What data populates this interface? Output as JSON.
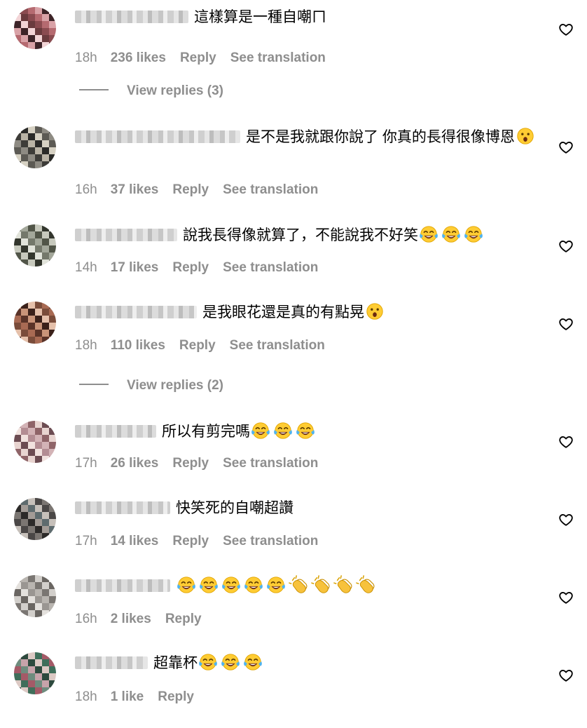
{
  "icons": {
    "like": "heart-outline-icon"
  },
  "comments": [
    {
      "text": "這樣算是一種自嘲ㄇ",
      "emoji": [],
      "time": "18h",
      "likes": "236 likes",
      "reply": "Reply",
      "translate": "See translation"
    },
    {
      "text": "是不是我就跟你說了 你真的長得很像博恩",
      "emoji": [
        "hushed-face"
      ],
      "time": "16h",
      "likes": "37 likes",
      "reply": "Reply",
      "translate": "See translation"
    },
    {
      "text": "說我長得像就算了，不能說我不好笑",
      "emoji": [
        "tears-of-joy",
        "tears-of-joy",
        "tears-of-joy"
      ],
      "time": "14h",
      "likes": "17 likes",
      "reply": "Reply",
      "translate": "See translation"
    },
    {
      "text": "是我眼花還是真的有點晃",
      "emoji": [
        "hushed-face"
      ],
      "time": "18h",
      "likes": "110 likes",
      "reply": "Reply",
      "translate": "See translation"
    },
    {
      "text": "所以有剪完嗎",
      "emoji": [
        "tears-of-joy",
        "tears-of-joy",
        "tears-of-joy"
      ],
      "time": "17h",
      "likes": "26 likes",
      "reply": "Reply",
      "translate": "See translation"
    },
    {
      "text": "快笑死的自嘲超讚",
      "emoji": [],
      "time": "17h",
      "likes": "14 likes",
      "reply": "Reply",
      "translate": "See translation"
    },
    {
      "text": "",
      "emoji": [
        "tears-of-joy",
        "tears-of-joy",
        "tears-of-joy",
        "tears-of-joy",
        "tears-of-joy",
        "clapping-hands",
        "clapping-hands",
        "clapping-hands",
        "clapping-hands"
      ],
      "time": "16h",
      "likes": "2 likes",
      "reply": "Reply",
      "translate": ""
    },
    {
      "text": "超靠杯",
      "emoji": [
        "tears-of-joy",
        "tears-of-joy",
        "tears-of-joy"
      ],
      "time": "18h",
      "likes": "1 like",
      "reply": "Reply",
      "translate": ""
    }
  ],
  "view_replies": [
    {
      "label": "View replies (3)"
    },
    {
      "label": "View replies (2)"
    }
  ],
  "colors": {
    "meta": "#8e8e8e",
    "text": "#000000",
    "background": "#ffffff"
  }
}
